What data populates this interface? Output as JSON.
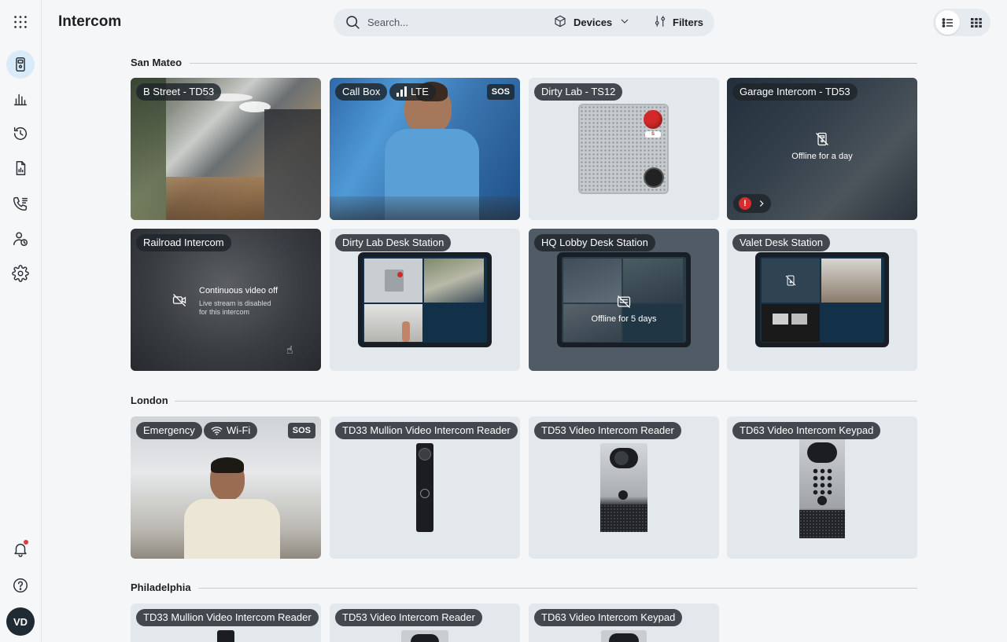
{
  "app": {
    "title": "Intercom"
  },
  "search": {
    "placeholder": "Search..."
  },
  "toolbar": {
    "devices_label": "Devices",
    "filters_label": "Filters"
  },
  "user": {
    "initials": "VD"
  },
  "sections": [
    {
      "name": "San Mateo",
      "cards": [
        {
          "title": "B Street - TD53"
        },
        {
          "title": "Call Box",
          "connection": "LTE",
          "badge": "SOS"
        },
        {
          "title": "Dirty Lab - TS12"
        },
        {
          "title": "Garage Intercom - TD53",
          "status": "Offline for a day"
        },
        {
          "title": "Railroad Intercom",
          "status_title": "Continuous video off",
          "status_detail": "Live stream is disabled for this intercom"
        },
        {
          "title": "Dirty Lab Desk Station"
        },
        {
          "title": "HQ Lobby Desk Station",
          "status": "Offline for 5 days"
        },
        {
          "title": "Valet Desk Station"
        }
      ]
    },
    {
      "name": "London",
      "cards": [
        {
          "title": "Emergency",
          "connection": "Wi-Fi",
          "badge": "SOS"
        },
        {
          "title": "TD33 Mullion Video Intercom Reader"
        },
        {
          "title": "TD53 Video Intercom Reader"
        },
        {
          "title": "TD63 Video Intercom Keypad"
        }
      ]
    },
    {
      "name": "Philadelphia",
      "cards": [
        {
          "title": "TD33 Mullion Video Intercom Reader"
        },
        {
          "title": "TD53 Video Intercom Reader"
        },
        {
          "title": "TD63 Video Intercom Keypad"
        }
      ]
    }
  ],
  "colors": {
    "accent_active": "#d9ebf9",
    "alert": "#d92d2d",
    "sos_red": "#e23a3a"
  }
}
